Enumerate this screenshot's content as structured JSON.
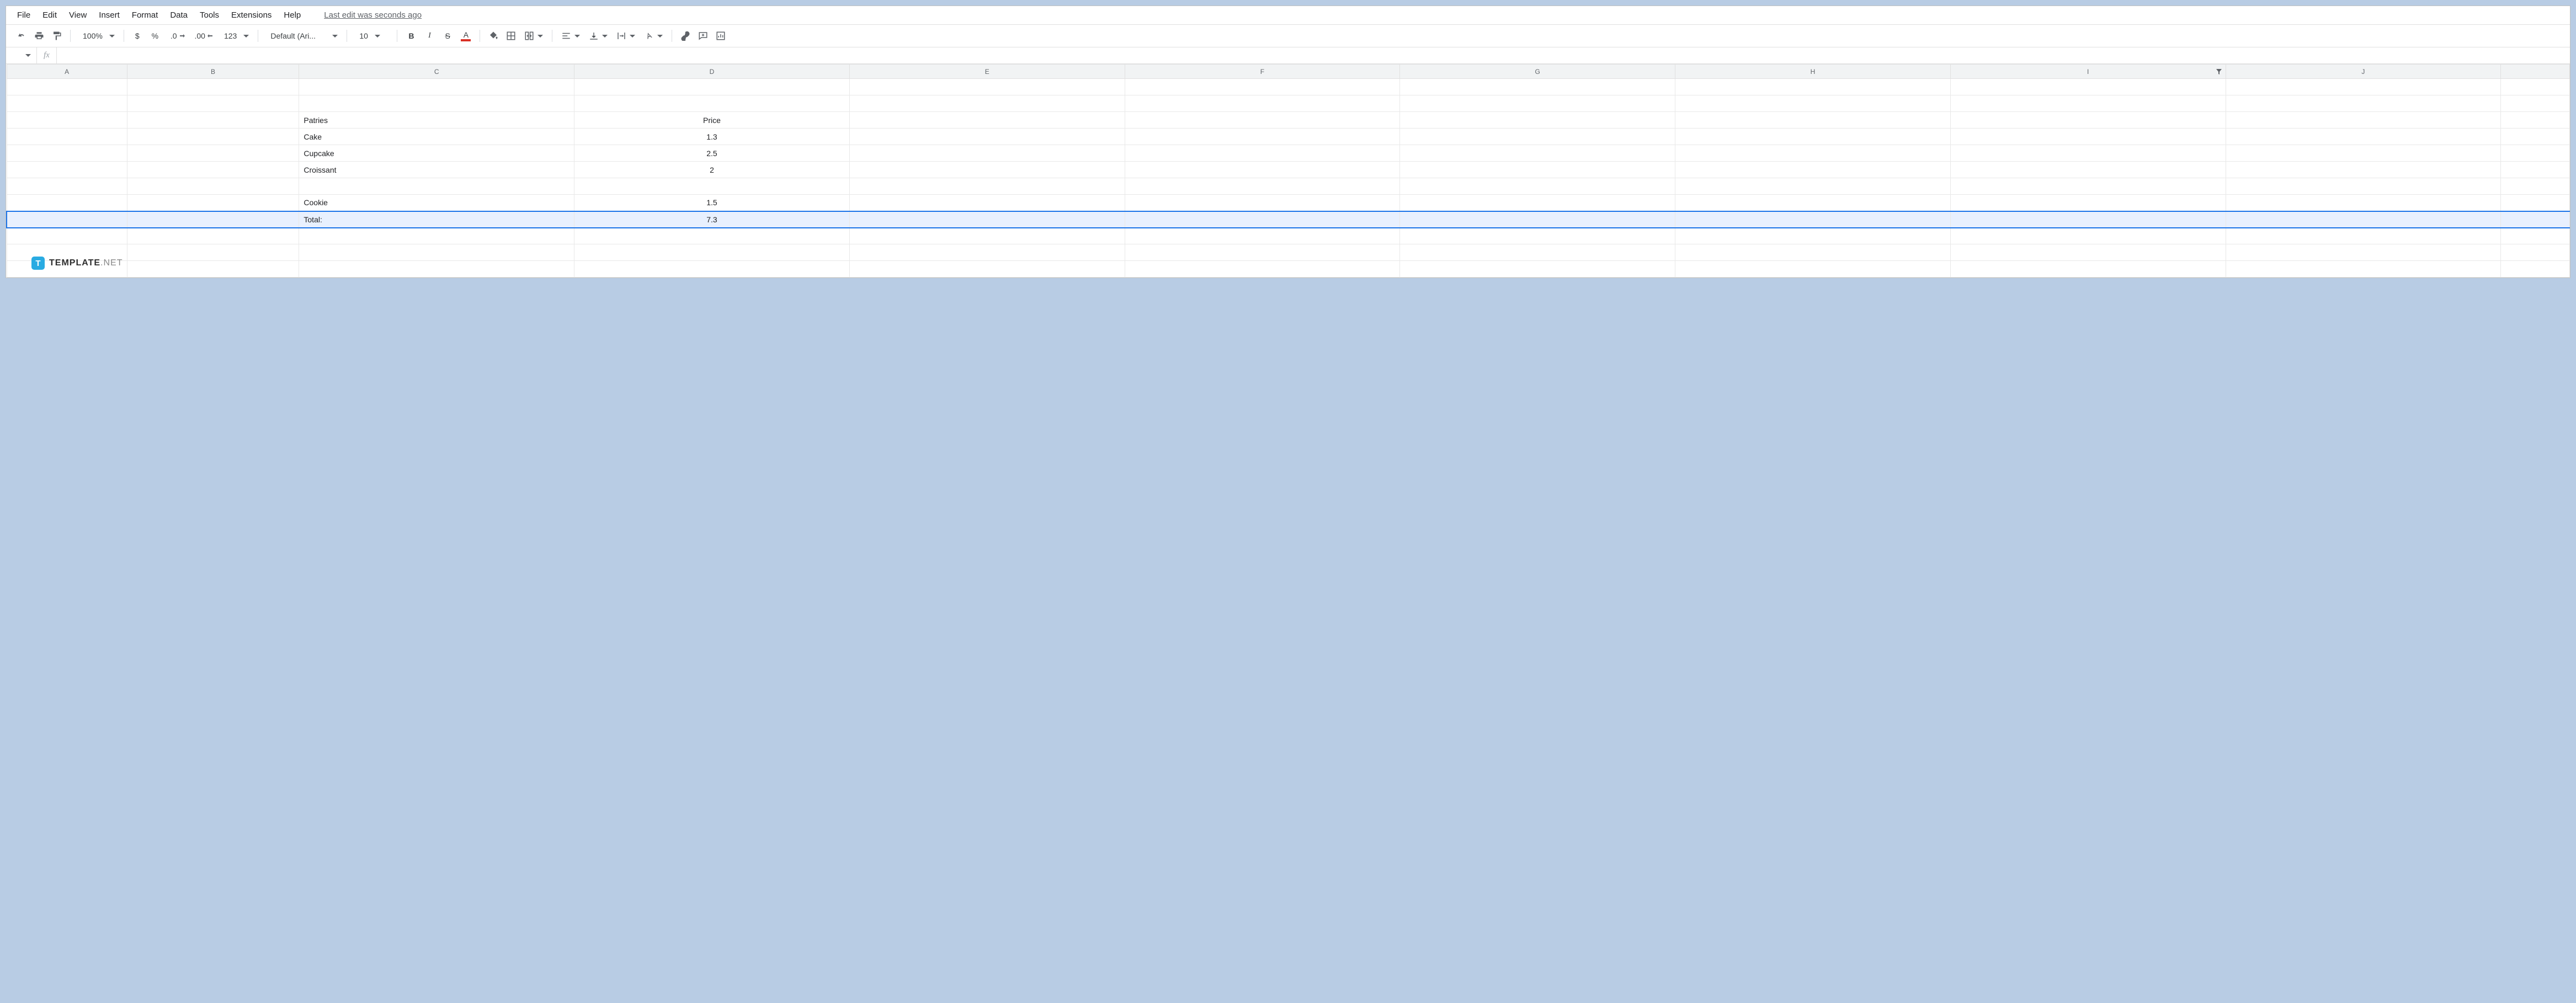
{
  "menu": {
    "file": "File",
    "edit": "Edit",
    "view": "View",
    "insert": "Insert",
    "format": "Format",
    "data": "Data",
    "tools": "Tools",
    "extensions": "Extensions",
    "help": "Help",
    "last_edit": "Last edit was seconds ago"
  },
  "toolbar": {
    "zoom": "100%",
    "currency": "$",
    "percent": "%",
    "dec_dec": ".0",
    "inc_dec": ".00",
    "num123": "123",
    "font": "Default (Ari...",
    "font_size": "10",
    "bold": "B",
    "italic": "I",
    "strike": "S",
    "text_color": "A"
  },
  "formula_bar": {
    "fx": "fx",
    "value": ""
  },
  "columns": [
    "A",
    "B",
    "C",
    "D",
    "E",
    "F",
    "G",
    "H",
    "I",
    "J"
  ],
  "filter_column": "I",
  "selected_row": 9,
  "row_count": 12,
  "cells": {
    "3": {
      "C": "Patries",
      "D": "Price"
    },
    "4": {
      "C": "Cake",
      "D": "1.3"
    },
    "5": {
      "C": "Cupcake",
      "D": "2.5"
    },
    "6": {
      "C": "Croissant",
      "D": "2"
    },
    "8": {
      "C": "Cookie",
      "D": "1.5"
    },
    "9": {
      "C": "Total:",
      "D": "7.3"
    }
  },
  "chart_data": {
    "type": "table",
    "title": "Patries Price",
    "columns": [
      "Patries",
      "Price"
    ],
    "rows": [
      [
        "Cake",
        1.3
      ],
      [
        "Cupcake",
        2.5
      ],
      [
        "Croissant",
        2
      ],
      [
        "Cookie",
        1.5
      ]
    ],
    "total": 7.3
  },
  "watermark": {
    "brand": "TEMPLATE",
    "suffix": ".NET",
    "badge": "T"
  }
}
